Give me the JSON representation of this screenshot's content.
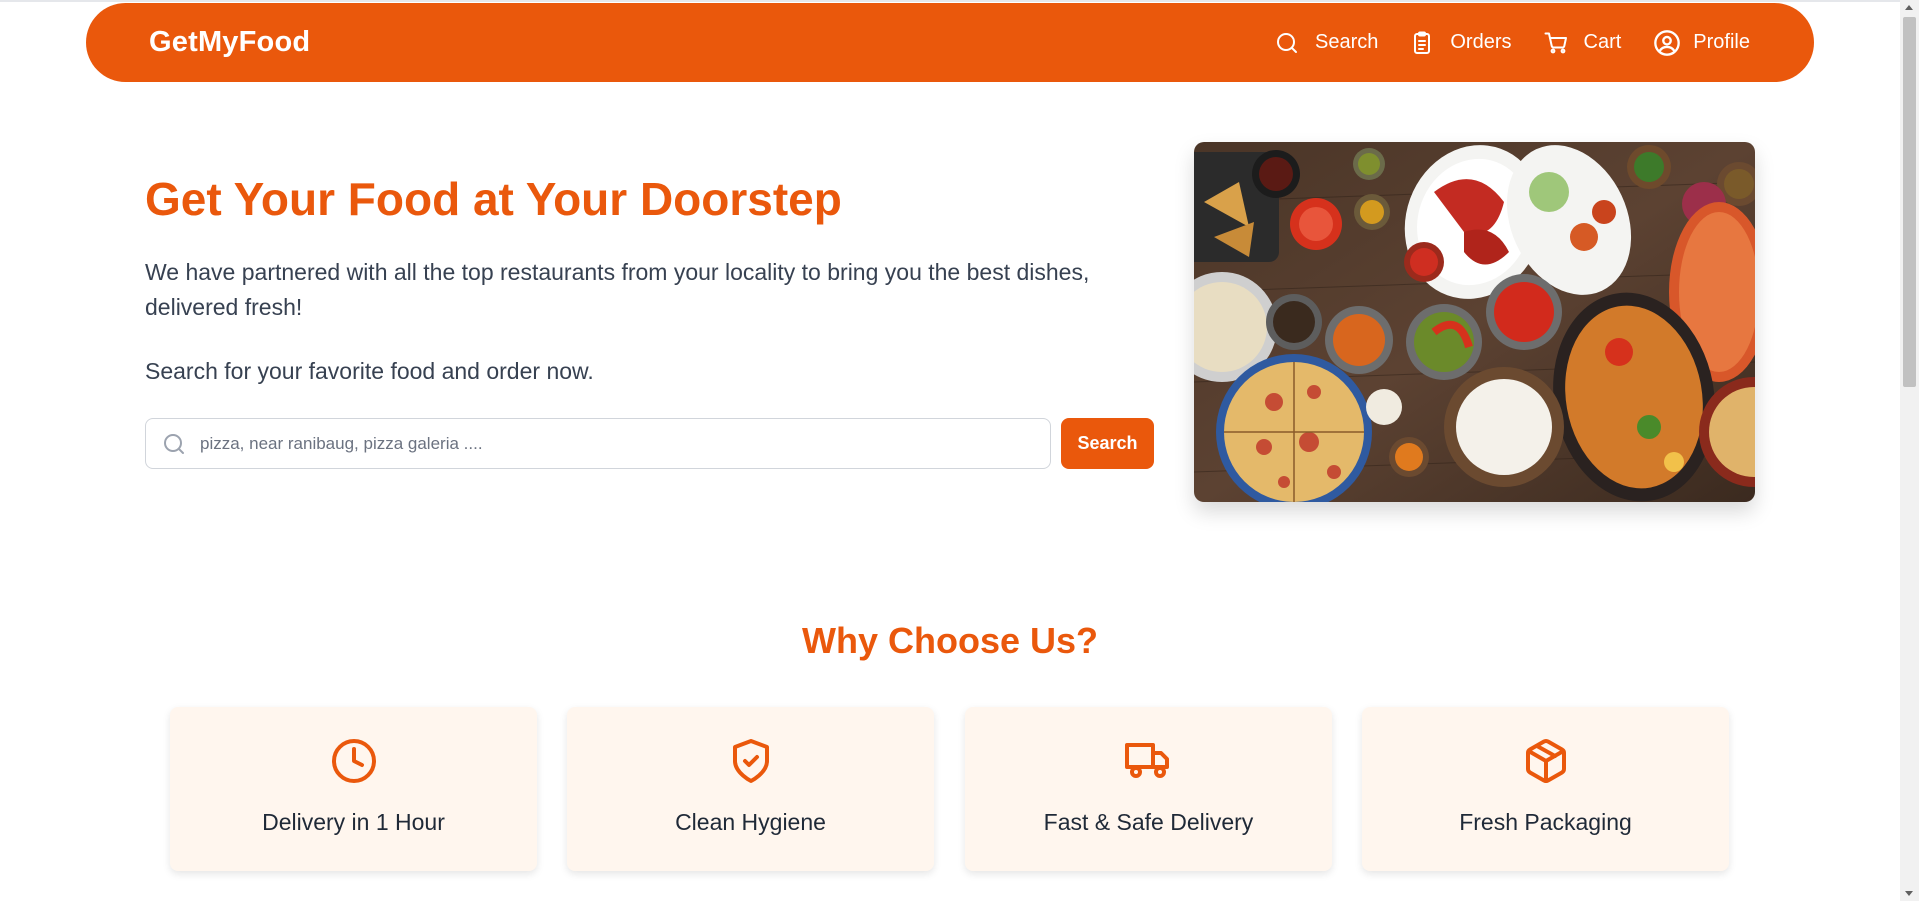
{
  "colors": {
    "brand": "#ea580c",
    "card_bg": "#fff6ee",
    "text": "#1f2937"
  },
  "navbar": {
    "brand": "GetMyFood",
    "links": [
      {
        "label": "Search",
        "icon": "search-icon"
      },
      {
        "label": "Orders",
        "icon": "clipboard-icon"
      },
      {
        "label": "Cart",
        "icon": "cart-icon"
      },
      {
        "label": "Profile",
        "icon": "user-circle-icon"
      }
    ]
  },
  "hero": {
    "title": "Get Your Food at Your Doorstep",
    "description": "We have partnered with all the top restaurants from your locality to bring you the best dishes, delivered fresh!",
    "cta_text": "Search for your favorite food and order now.",
    "search": {
      "placeholder": "pizza, near ranibaug, pizza galeria ....",
      "value": "",
      "button_label": "Search"
    },
    "image": "indian-food-spread-image"
  },
  "why_choose_us": {
    "title": "Why Choose Us?",
    "features": [
      {
        "label": "Delivery in 1 Hour",
        "icon": "clock-icon"
      },
      {
        "label": "Clean Hygiene",
        "icon": "shield-check-icon"
      },
      {
        "label": "Fast & Safe Delivery",
        "icon": "truck-icon"
      },
      {
        "label": "Fresh Packaging",
        "icon": "package-icon"
      }
    ]
  }
}
